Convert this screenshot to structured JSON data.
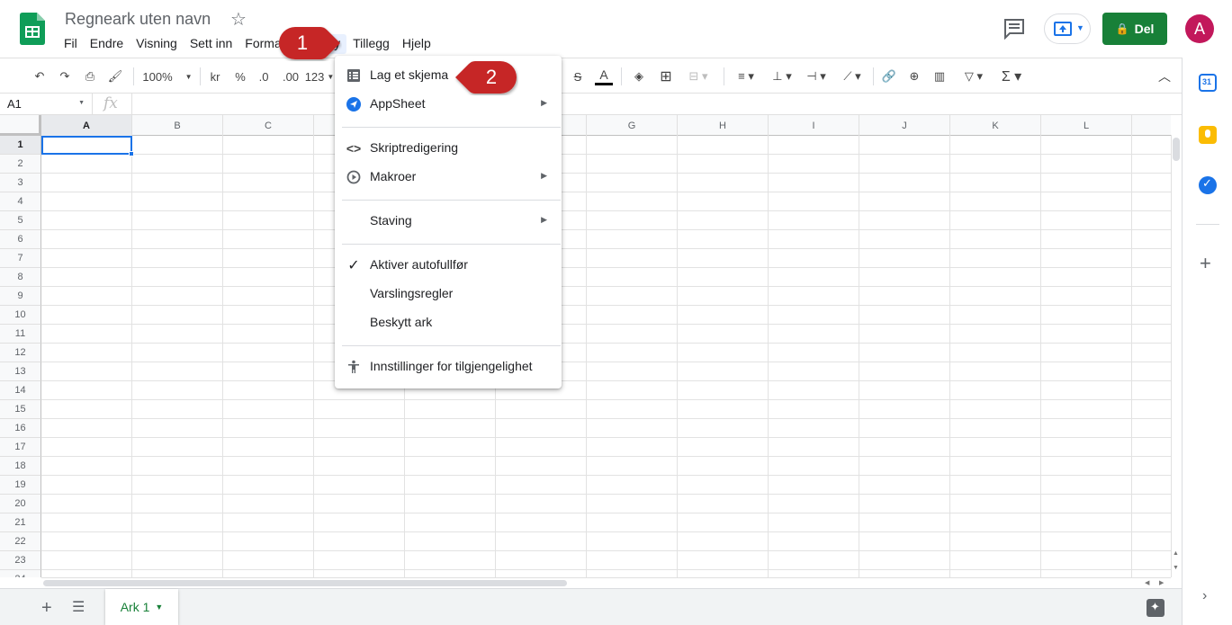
{
  "app": {
    "doc_title": "Regneark uten navn",
    "share_label": "Del",
    "avatar_letter": "A",
    "brand_color": "#188038"
  },
  "menubar": {
    "items": [
      "Fil",
      "Endre",
      "Visning",
      "Sett inn",
      "Format",
      "Verktøy",
      "Tillegg",
      "Hjelp"
    ],
    "active": "Verktøy"
  },
  "toolbar": {
    "zoom": "100%",
    "currency": "kr",
    "percent": "%",
    "dec_decrease": ".0",
    "dec_increase": ".00",
    "more_formats": "123"
  },
  "formulabar": {
    "cell_ref": "A1",
    "fx": "fx"
  },
  "grid": {
    "columns": [
      "A",
      "B",
      "C",
      "D",
      "E",
      "F",
      "G",
      "H",
      "I",
      "J",
      "K",
      "L"
    ],
    "rows": [
      "1",
      "2",
      "3",
      "4",
      "5",
      "6",
      "7",
      "8",
      "9",
      "10",
      "11",
      "12",
      "13",
      "14",
      "15",
      "16",
      "17",
      "18",
      "19",
      "20",
      "21",
      "22",
      "23",
      "24"
    ],
    "selected_cell": "A1"
  },
  "sheets": {
    "tabs": [
      "Ark 1"
    ],
    "active": "Ark 1"
  },
  "dropdown": {
    "items": [
      {
        "label": "Lag et skjema",
        "icon": "form-icon",
        "submenu": false
      },
      {
        "label": "AppSheet",
        "icon": "appsheet-icon",
        "submenu": true
      },
      {
        "label": "Skriptredigering",
        "icon": "code-icon",
        "submenu": false
      },
      {
        "label": "Makroer",
        "icon": "play-circle-icon",
        "submenu": true
      },
      {
        "label": "Staving",
        "icon": "",
        "submenu": true
      },
      {
        "label": "Aktiver autofullfør",
        "icon": "check-icon",
        "submenu": false
      },
      {
        "label": "Varslingsregler",
        "icon": "",
        "submenu": false
      },
      {
        "label": "Beskytt ark",
        "icon": "",
        "submenu": false
      },
      {
        "label": "Innstillinger for tilgjengelighet",
        "icon": "accessibility-icon",
        "submenu": false
      }
    ]
  },
  "callouts": [
    {
      "number": "1",
      "color": "#c62828"
    },
    {
      "number": "2",
      "color": "#c62828"
    }
  ]
}
